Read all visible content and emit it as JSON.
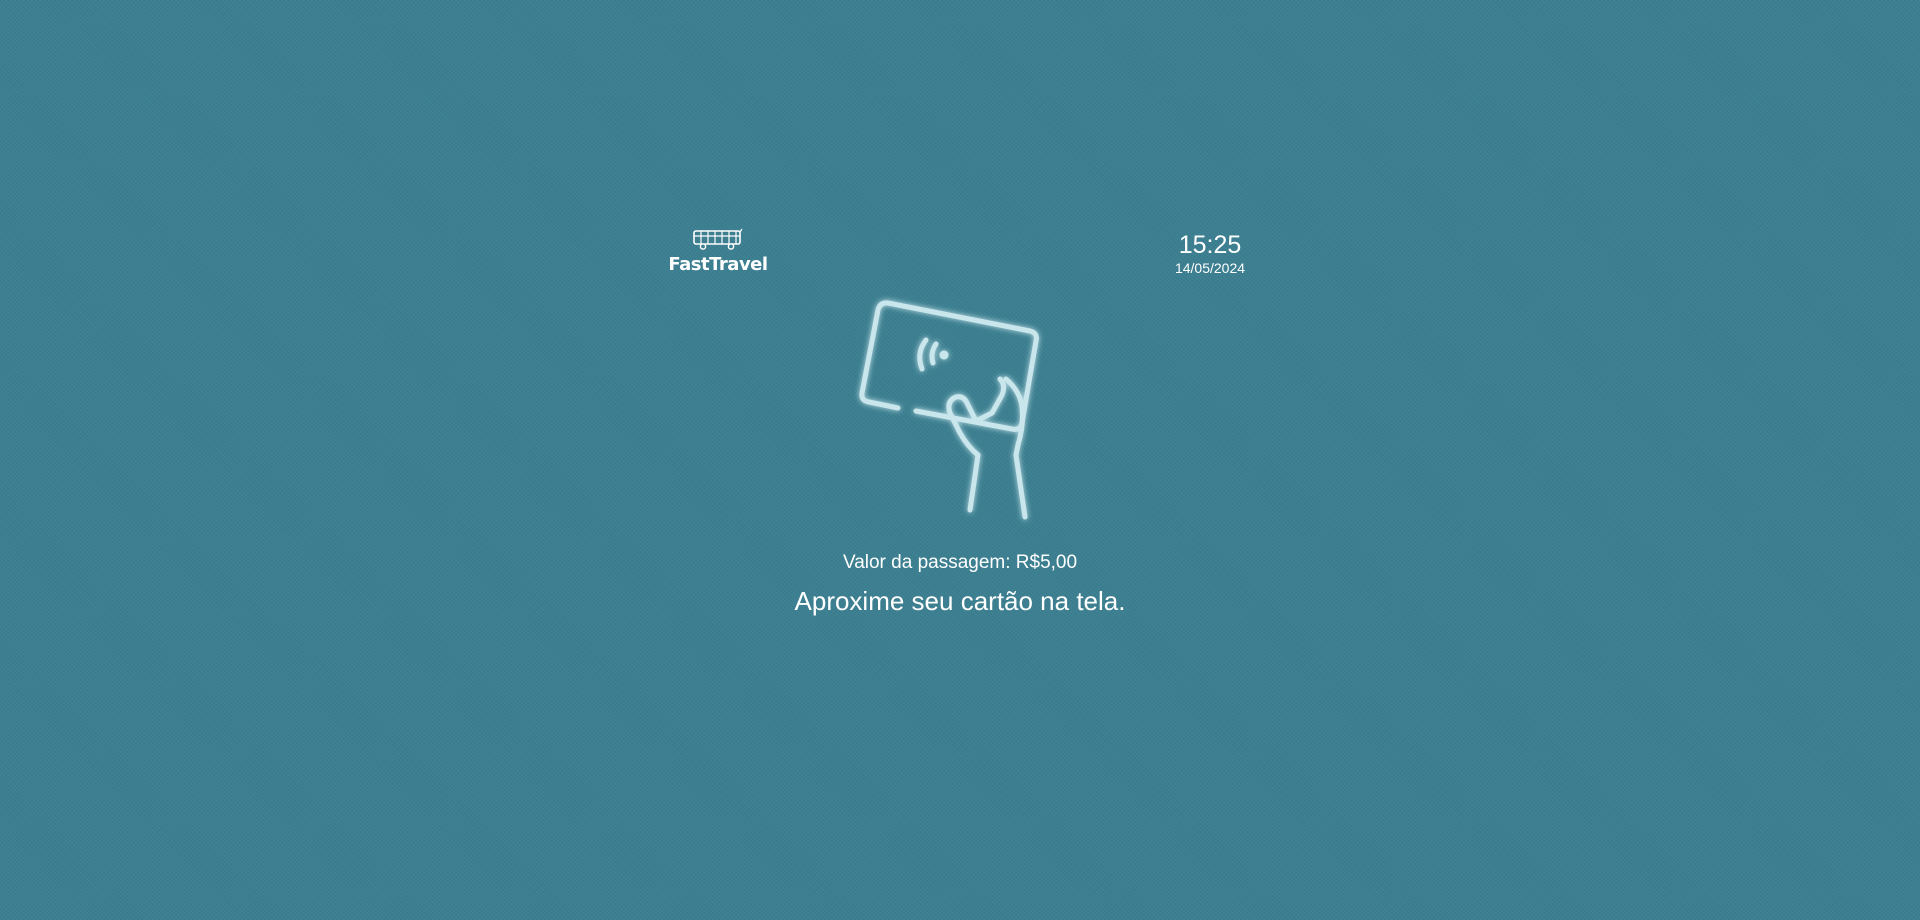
{
  "header": {
    "brand": "FastTravel",
    "logo_icon": "bus-icon",
    "time": "15:25",
    "date": "14/05/2024"
  },
  "main": {
    "illustration_icon": "hand-holding-contactless-card-icon",
    "fare_text": "Valor da passagem: R$5,00",
    "instruction": "Aproxime seu cartão na tela."
  },
  "colors": {
    "background": "#3b7f91",
    "text": "#ffffff",
    "illustration_stroke": "#c9e6ec"
  }
}
